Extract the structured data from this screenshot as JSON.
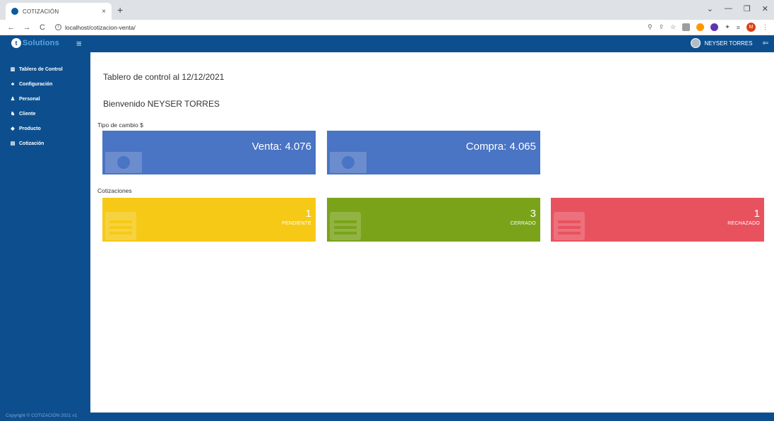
{
  "browser": {
    "tab_title": "COTIZACIÓN",
    "tab_close": "×",
    "new_tab": "+",
    "url": "localhost/cotizacion-venta/",
    "window_controls": [
      "⌄",
      "—",
      "❐",
      "✕"
    ]
  },
  "header": {
    "brand": "Solutions",
    "user_name": "NEYSER TORRES"
  },
  "sidebar": {
    "items": [
      {
        "label": "Tablero de Control",
        "icon": "chart-icon"
      },
      {
        "label": "Configuración",
        "icon": "sitemap-icon"
      },
      {
        "label": "Personal",
        "icon": "user-icon"
      },
      {
        "label": "Cliente",
        "icon": "users-icon"
      },
      {
        "label": "Producto",
        "icon": "tag-icon"
      },
      {
        "label": "Cotización",
        "icon": "table-icon"
      }
    ],
    "copyright": "Copyright © COTIZACIÓN 2021 v1"
  },
  "main": {
    "title": "Tablero de control al 12/12/2021",
    "welcome": "Bienvenido NEYSER TORRES",
    "exchange_label": "Tipo de cambio $",
    "venta": "Venta: 4.076",
    "compra": "Compra: 4.065",
    "quotes_label": "Cotizaciones",
    "quotes": [
      {
        "count": "1",
        "status": "PENDIENTE",
        "color": "#f6c916"
      },
      {
        "count": "3",
        "status": "CERRADO",
        "color": "#7aa31a"
      },
      {
        "count": "1",
        "status": "RECHAZADO",
        "color": "#e8525f"
      }
    ]
  },
  "colors": {
    "primary": "#0d4f8e",
    "exchange_card": "#4a74c4"
  }
}
